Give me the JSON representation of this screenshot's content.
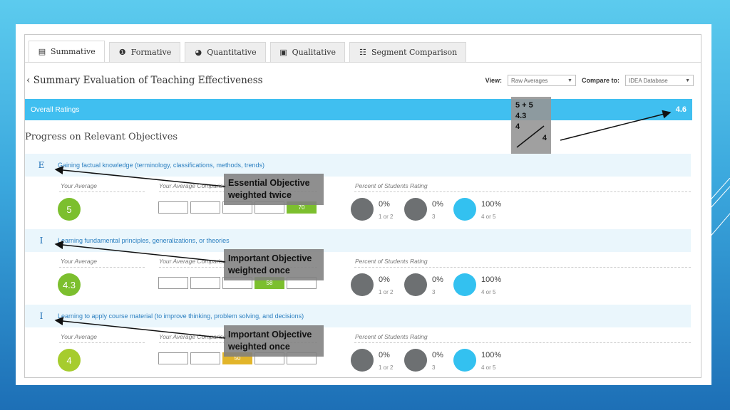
{
  "tabs": [
    {
      "label": "Summative",
      "icon": "bar-chart-icon",
      "glyph": "▤",
      "active": true
    },
    {
      "label": "Formative",
      "icon": "info-icon",
      "glyph": "❶",
      "active": false
    },
    {
      "label": "Quantitative",
      "icon": "pie-chart-icon",
      "glyph": "◕",
      "active": false
    },
    {
      "label": "Qualitative",
      "icon": "document-icon",
      "glyph": "▣",
      "active": false
    },
    {
      "label": "Segment Comparison",
      "icon": "sliders-icon",
      "glyph": "☷",
      "active": false
    }
  ],
  "header": {
    "title": "‹ Summary Evaluation of Teaching Effectiveness",
    "view_label": "View:",
    "view_value": "Raw Averages",
    "compare_label": "Compare to:",
    "compare_value": "IDEA Database"
  },
  "overall": {
    "label": "Overall Ratings",
    "score": "4.6"
  },
  "section_title": "Progress on Relevant Objectives",
  "columns": {
    "your_average": "Your Average",
    "your_average_comparison": "Your Average Comparison",
    "percent_rating": "Percent of Students Rating"
  },
  "objectives": [
    {
      "letter": "E",
      "text": "Gaining factual knowledge (terminology, classifications, methods, trends)",
      "average": "5",
      "avg_color": "#7cbf2e",
      "comparison_highlight": {
        "index": 4,
        "value": "70",
        "color": "#7cbf2e"
      },
      "percents": [
        {
          "value": "0%",
          "label": "1 or 2",
          "color": "#6d7072"
        },
        {
          "value": "0%",
          "label": "3",
          "color": "#6d7072"
        },
        {
          "value": "100%",
          "label": "4 or 5",
          "color": "#33c1f0"
        }
      ],
      "callout": [
        "Essential Objective",
        "weighted twice"
      ]
    },
    {
      "letter": "I",
      "text": "Learning fundamental principles, generalizations, or theories",
      "average": "4.3",
      "avg_color": "#7cbf2e",
      "comparison_highlight": {
        "index": 3,
        "value": "58",
        "color": "#7cbf2e"
      },
      "percents": [
        {
          "value": "0%",
          "label": "1 or 2",
          "color": "#6d7072"
        },
        {
          "value": "0%",
          "label": "3",
          "color": "#6d7072"
        },
        {
          "value": "100%",
          "label": "4 or 5",
          "color": "#33c1f0"
        }
      ],
      "callout": [
        "Important Objective",
        "weighted once"
      ]
    },
    {
      "letter": "I",
      "text": "Learning to apply course material (to improve thinking, problem solving, and decisions)",
      "average": "4",
      "avg_color": "#a6cc2e",
      "comparison_highlight": {
        "index": 2,
        "value": "50",
        "color": "#e2b52a"
      },
      "percents": [
        {
          "value": "0%",
          "label": "1 or 2",
          "color": "#6d7072"
        },
        {
          "value": "0%",
          "label": "3",
          "color": "#6d7072"
        },
        {
          "value": "100%",
          "label": "4 or 5",
          "color": "#33c1f0"
        }
      ],
      "callout": [
        "Important Objective",
        "weighted once"
      ]
    }
  ],
  "note": {
    "line1": "5 + 5",
    "line2": "4.3",
    "numerator": "4",
    "denominator": "4"
  }
}
